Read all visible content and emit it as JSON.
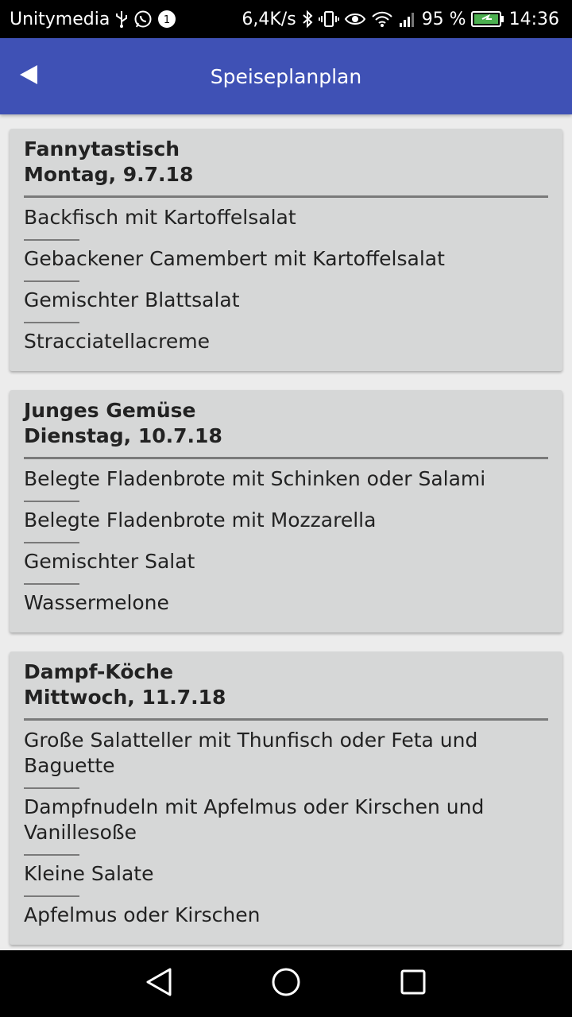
{
  "status_bar": {
    "carrier": "Unitymedia",
    "network_speed": "6,4K/s",
    "battery_percent": "95 %",
    "time": "14:36",
    "icons_left": [
      "usb-icon",
      "whatsapp-icon",
      "notification-badge-icon"
    ],
    "icons_right": [
      "bluetooth-icon",
      "vibrate-icon",
      "eye-icon",
      "wifi-icon",
      "signal-icon",
      "battery-icon"
    ]
  },
  "app_bar": {
    "title": "Speiseplanplan",
    "color": "#3f51b5"
  },
  "days": [
    {
      "name": "Fannytastisch",
      "date": "Montag, 9.7.18",
      "items": [
        "Backfisch mit Kartoffelsalat",
        "Gebackener Camembert mit Kartoffelsalat",
        "Gemischter Blattsalat",
        "Stracciatellacreme"
      ]
    },
    {
      "name": "Junges Gemüse",
      "date": "Dienstag, 10.7.18",
      "items": [
        "Belegte Fladenbrote mit Schinken oder Salami",
        "Belegte Fladenbrote mit Mozzarella",
        "Gemischter Salat",
        "Wassermelone"
      ]
    },
    {
      "name": "Dampf-Köche",
      "date": "Mittwoch, 11.7.18",
      "items": [
        "Große Salatteller mit Thunfisch oder Feta und Baguette",
        "Dampfnudeln mit Apfelmus oder Kirschen und Vanillesoße",
        "Kleine Salate",
        "Apfelmus oder Kirschen"
      ]
    }
  ],
  "nav_bar": {
    "buttons": [
      "back-triangle-icon",
      "home-circle-icon",
      "recents-square-icon"
    ]
  }
}
